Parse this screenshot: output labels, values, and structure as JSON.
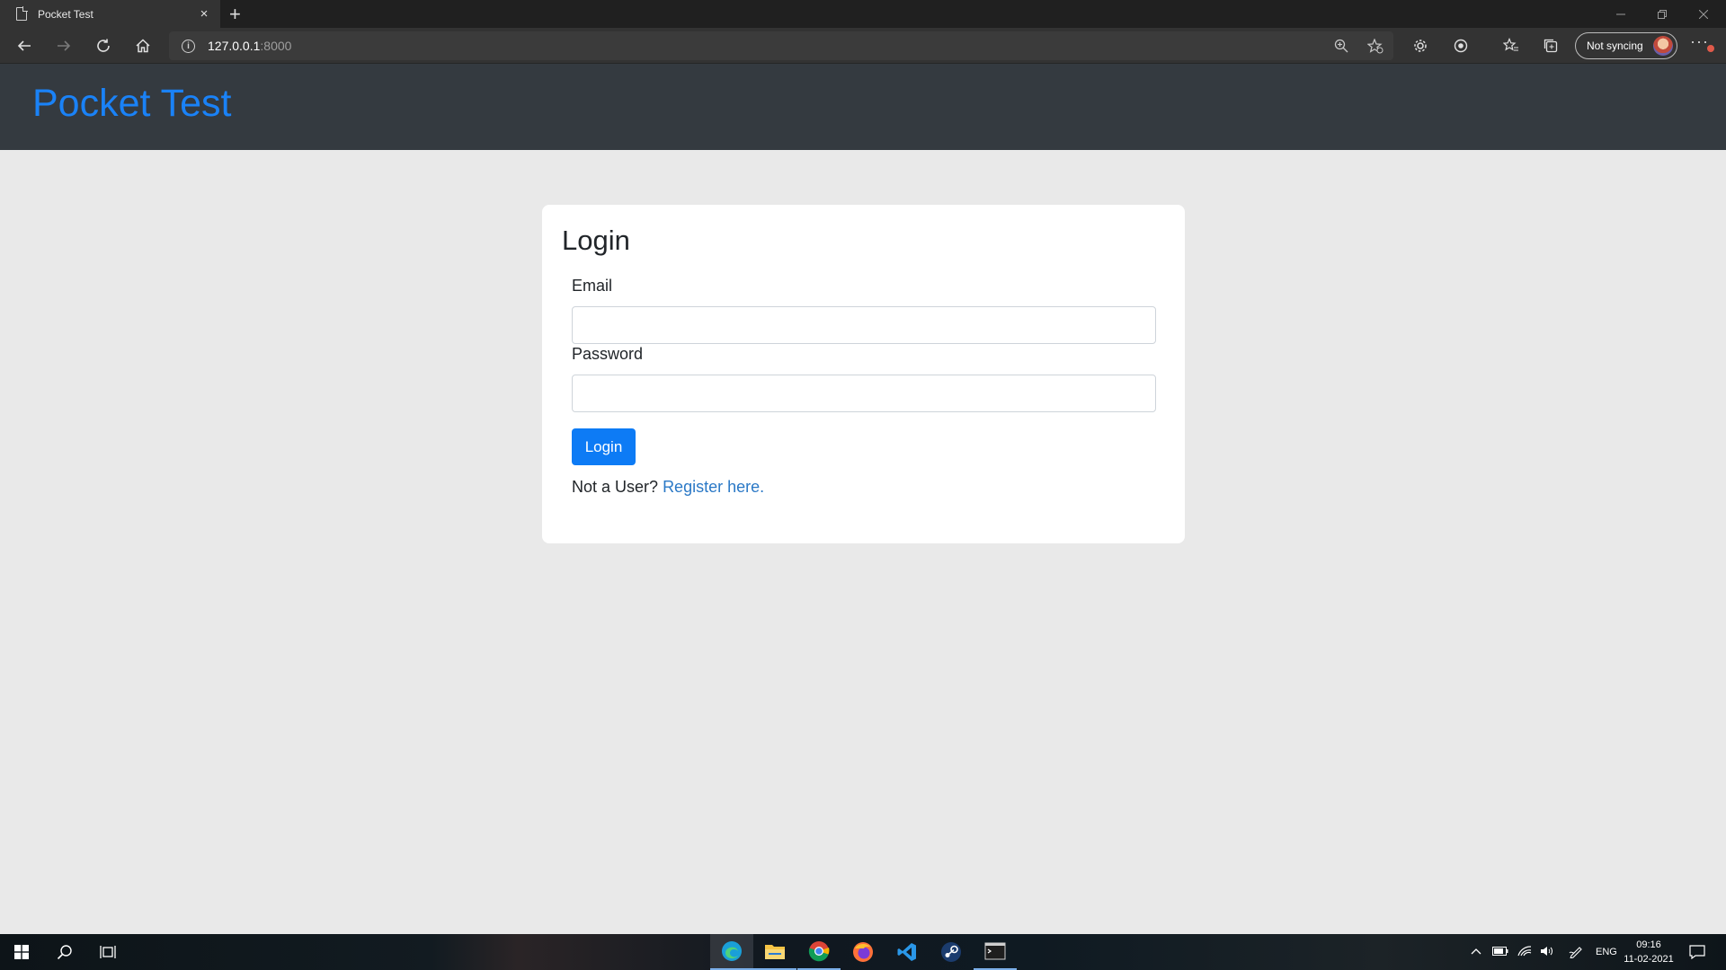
{
  "browser": {
    "tab_title": "Pocket Test",
    "tab_close": "×",
    "new_tab": "+",
    "url_host": "127.0.0.1",
    "url_port": ":8000",
    "sync_label": "Not syncing",
    "more": "···"
  },
  "header": {
    "brand": "Pocket Test",
    "brand_color": "#1a82f7"
  },
  "login_card": {
    "title": "Login",
    "email_label": "Email",
    "email_value": "",
    "password_label": "Password",
    "password_value": "",
    "submit_label": "Login",
    "register_prompt": "Not a User?",
    "register_link": "Register here."
  },
  "taskbar": {
    "language": "ENG",
    "time": "09:16",
    "date": "11-02-2021",
    "apps": [
      "edge-icon",
      "file-explorer-icon",
      "chrome-icon",
      "firefox-icon",
      "vscode-icon",
      "steam-icon",
      "terminal-icon"
    ]
  }
}
